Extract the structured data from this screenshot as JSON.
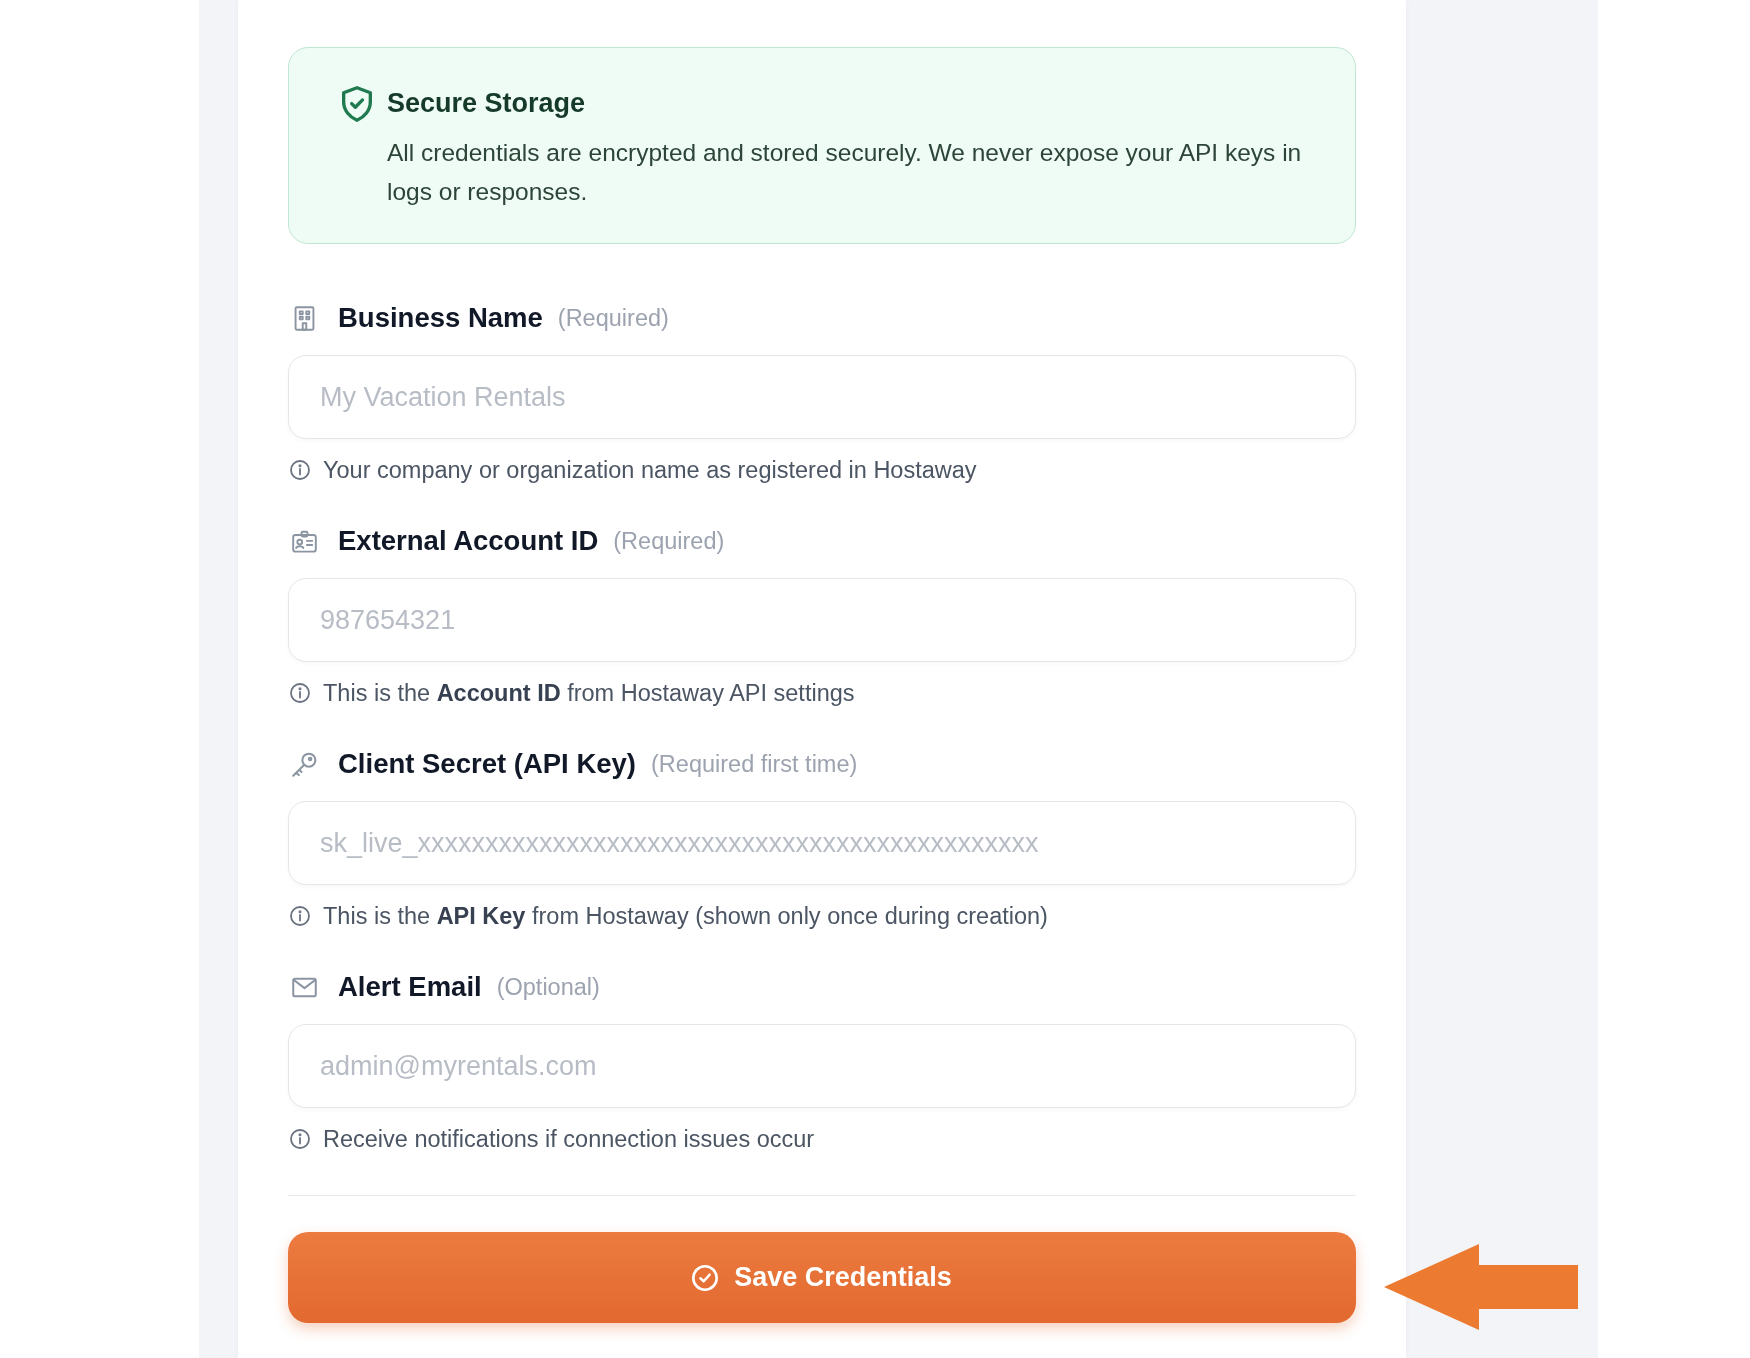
{
  "notice": {
    "title": "Secure Storage",
    "text": "All credentials are encrypted and stored securely. We never expose your API keys in logs or responses."
  },
  "fields": [
    {
      "kind": "name",
      "label": "Business Name",
      "note": "(Required)",
      "placeholder": "My Vacation Rentals",
      "help": "Your company or organization name as registered in Hostaway"
    },
    {
      "kind": "id",
      "label": "External Account ID",
      "note": "(Required)",
      "placeholder": "987654321",
      "help": "This is the **Account ID** from Hostaway API settings"
    },
    {
      "kind": "secret",
      "label": "Client Secret (API Key)",
      "note": "(Required first time)",
      "placeholder": "sk_live_xxxxxxxxxxxxxxxxxxxxxxxxxxxxxxxxxxxxxxxxxxxxxx",
      "help": "This is the **API Key** from Hostaway (shown only once during creation)"
    },
    {
      "kind": "email",
      "label": "Alert Email",
      "note": "(Optional)",
      "placeholder": "admin@myrentals.com",
      "help": "Receive notifications if connection issues occur"
    }
  ],
  "save_button": {
    "label": "Save Credentials"
  }
}
